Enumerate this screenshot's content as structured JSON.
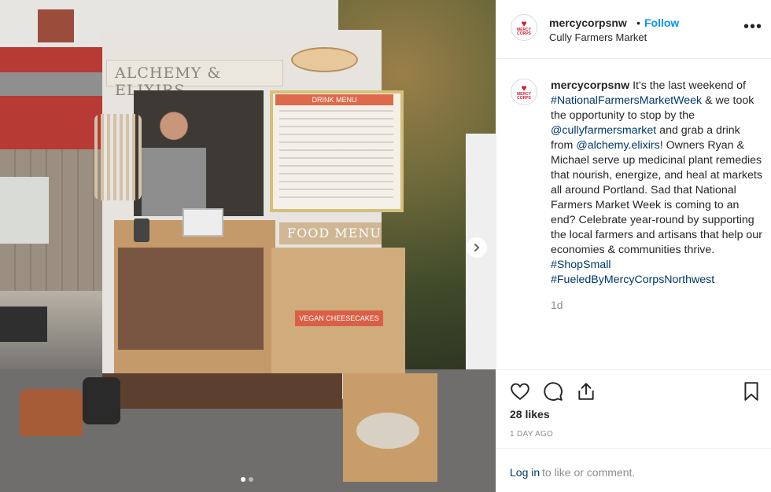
{
  "photo": {
    "truck_sign": "ALCHEMY & ELIXIRS",
    "menu_title": "DRINK MENU",
    "food_menu": "FOOD MENU",
    "vegan_sign": "VEGAN CHEESECAKES",
    "carousel_index": 1,
    "carousel_count": 2
  },
  "header": {
    "username": "mercycorpsnw",
    "separator": "•",
    "follow_label": "Follow",
    "location": "Cully Farmers Market",
    "more_label": "•••",
    "avatar_brand": "MERCY CORPS"
  },
  "caption": {
    "username": "mercycorpsnw",
    "t1": " It's the last weekend of ",
    "h1": "#NationalFarmersMarketWeek",
    "t2": " & we took the opportunity to stop by the ",
    "m1": "@cullyfarmersmarket",
    "t3": " and grab a drink from ",
    "m2": "@alchemy.elixirs",
    "t4": "! Owners Ryan & Michael serve up medicinal plant remedies that nourish, energize, and heal at markets all around Portland. Sad that National Farmers Market Week is coming to an end? Celebrate year-round by supporting the local farmers and artisans that help our economies & communities thrive. ",
    "h2": "#ShopSmall",
    "t5": " ",
    "h3": "#FueledByMercyCorpsNorthwest",
    "age": "1d"
  },
  "actions": {
    "likes": "28 likes",
    "age": "1 DAY AGO"
  },
  "comment": {
    "login_label": "Log in",
    "rest": " to like or comment."
  },
  "colors": {
    "link_blue": "#0095f6",
    "mention_blue": "#00376b",
    "brand_red": "#d11f2e",
    "muted_gray": "#8e8e8e"
  }
}
